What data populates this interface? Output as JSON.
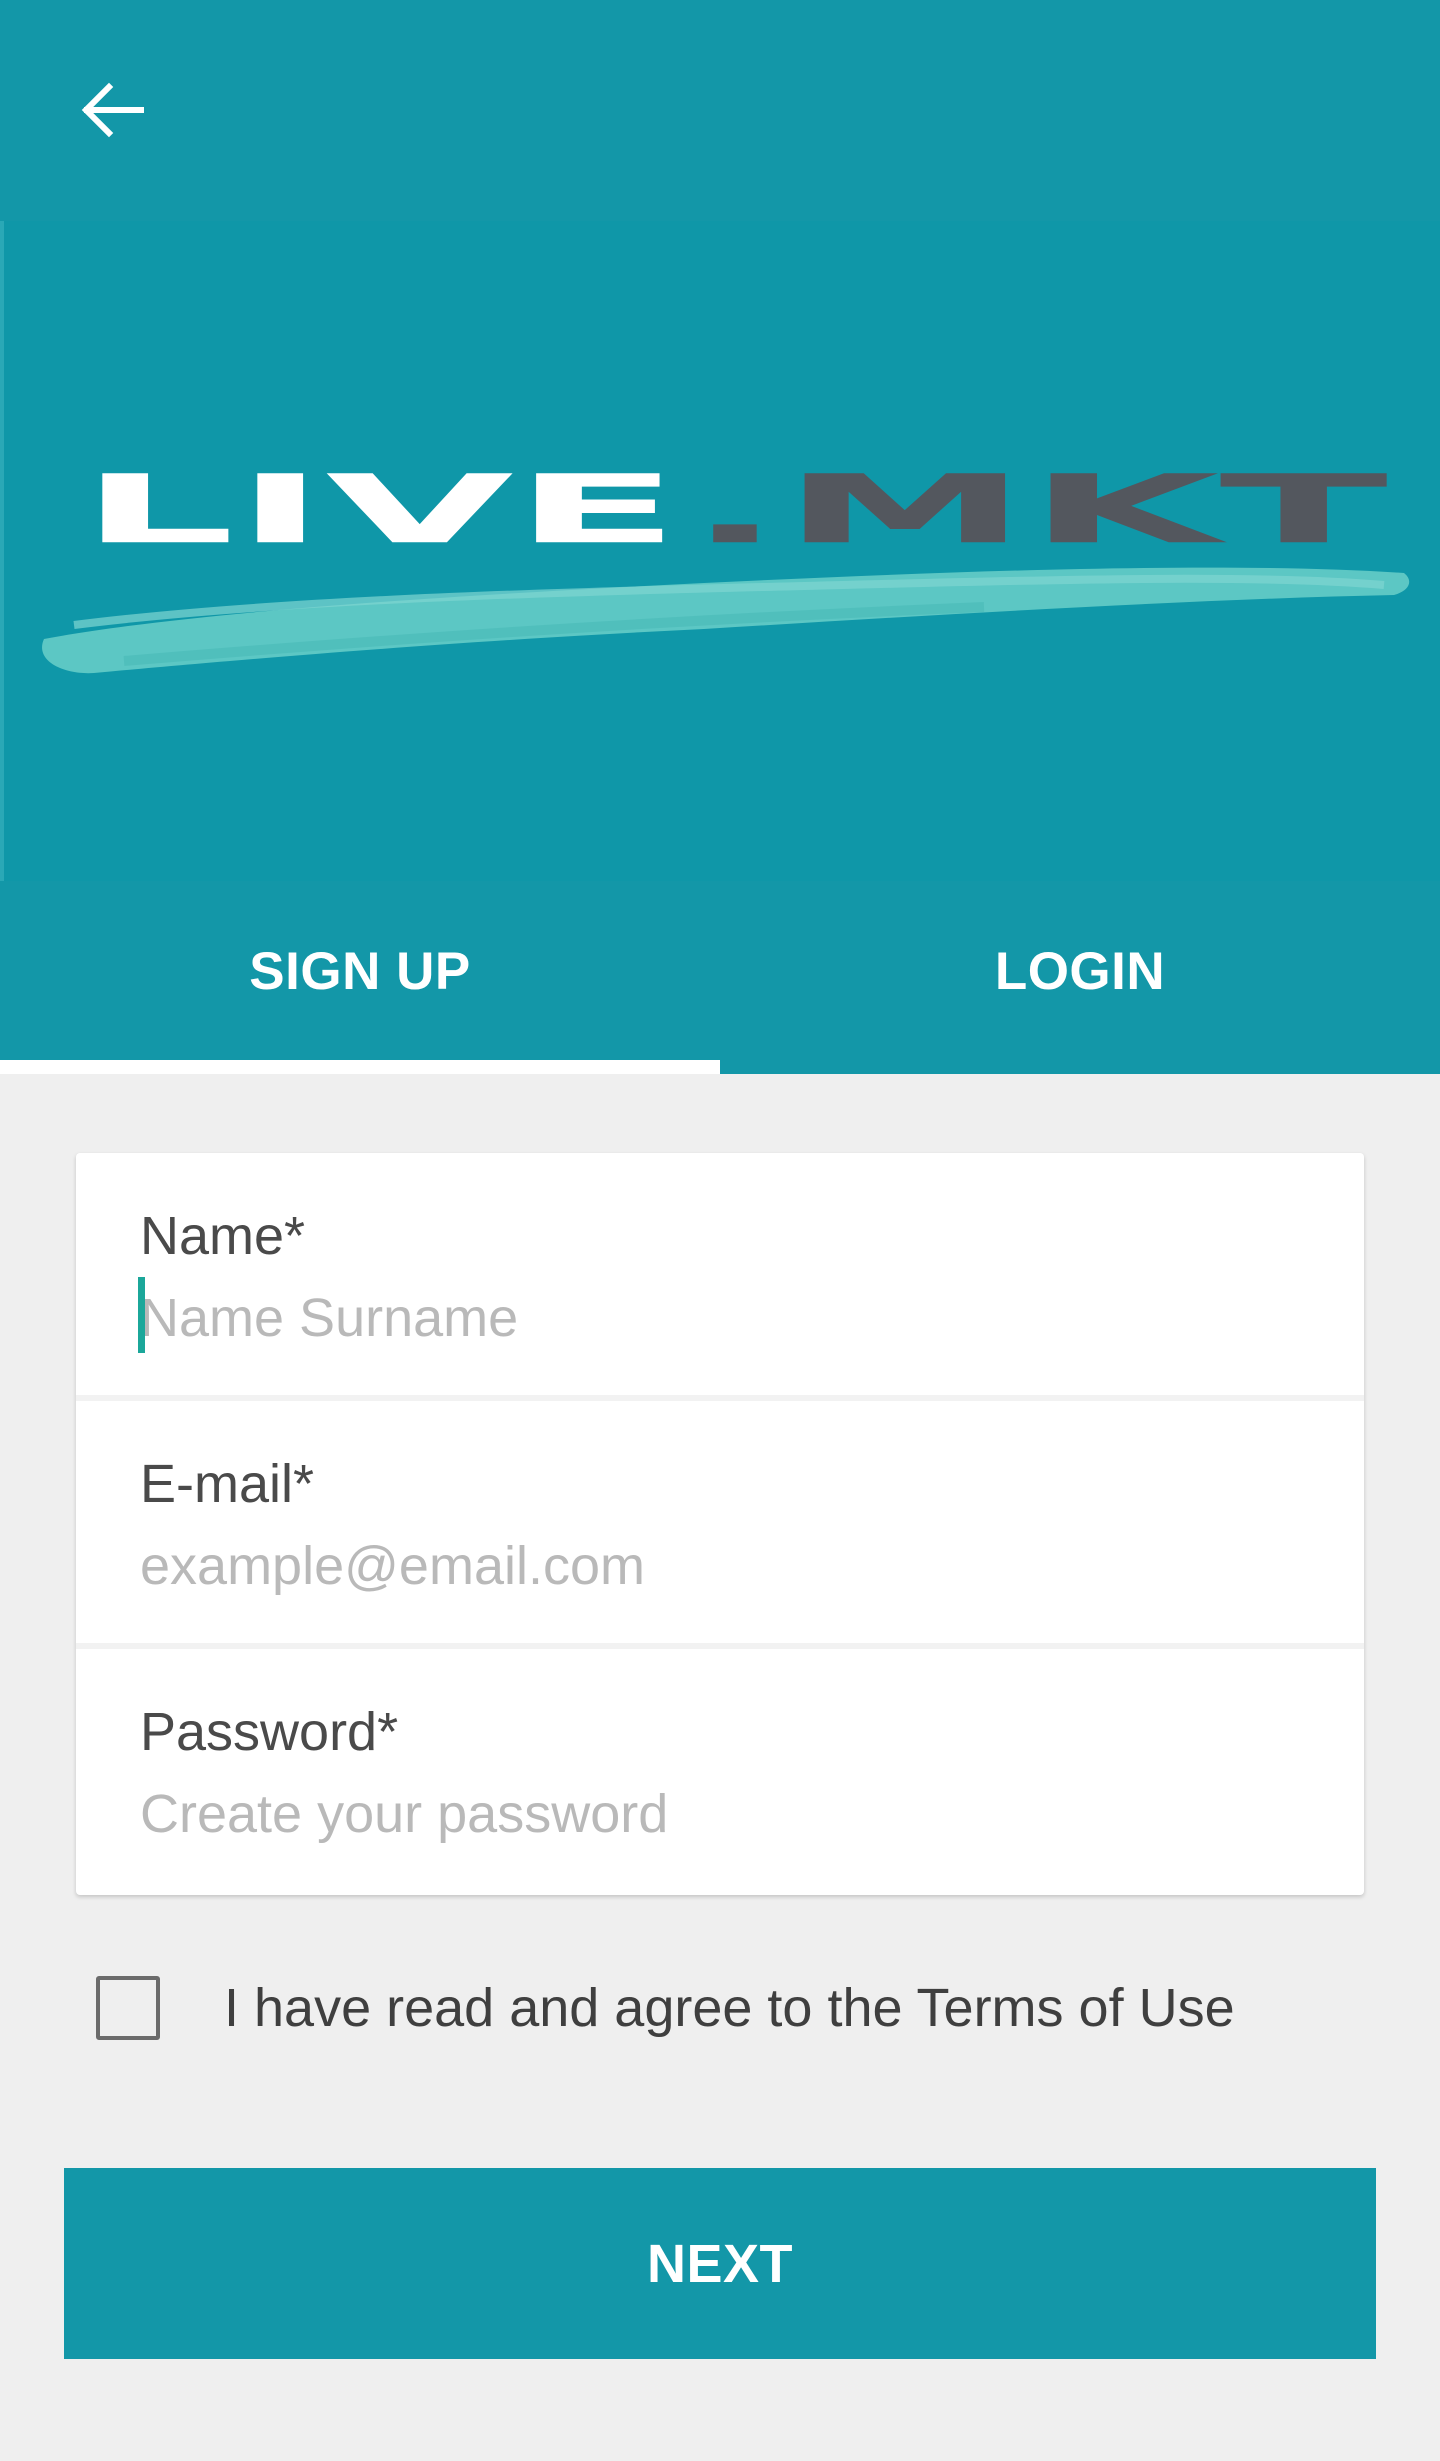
{
  "header": {
    "back_icon": "arrow-left-icon",
    "background_color": "#1397a8"
  },
  "banner": {
    "logo_text": "LIVE.MKT",
    "logo_part_light": "LIVE",
    "logo_part_dark": ".MKT",
    "colors": {
      "background": "#0f97a8",
      "light_text": "#ffffff",
      "dark_text": "#53575e",
      "brush": "#5cc7c4"
    }
  },
  "tabs": [
    {
      "label": "SIGN UP",
      "selected": true
    },
    {
      "label": "LOGIN",
      "selected": false
    }
  ],
  "form": {
    "name": {
      "label": "Name*",
      "placeholder": "Name Surname",
      "value": ""
    },
    "email": {
      "label": "E-mail*",
      "placeholder": "example@email.com",
      "value": ""
    },
    "password": {
      "label": "Password*",
      "placeholder": "Create your password",
      "value": ""
    }
  },
  "terms": {
    "checked": false,
    "label": "I have read and agree to the Terms of Use"
  },
  "next_button": {
    "label": "NEXT"
  },
  "colors": {
    "accent": "#1397a8",
    "page_background": "#efefef",
    "cursor": "#1ba79a"
  }
}
